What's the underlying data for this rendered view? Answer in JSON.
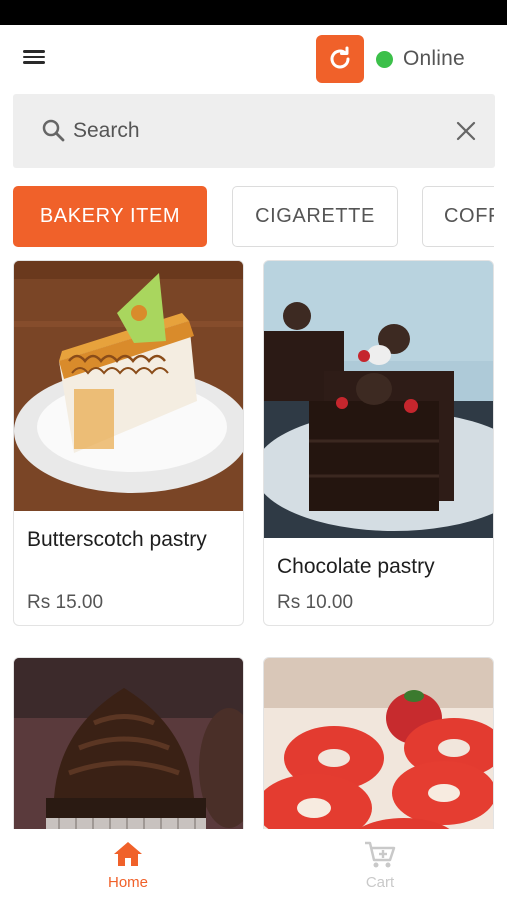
{
  "header": {
    "status": "Online",
    "colors": {
      "accent": "#f0612a",
      "online": "#3cc04a"
    },
    "icons": [
      "menu-icon",
      "refresh-icon"
    ]
  },
  "search": {
    "placeholder": "Search",
    "value": ""
  },
  "categories": [
    {
      "label": "BAKERY ITEM",
      "active": true
    },
    {
      "label": "CIGARETTE",
      "active": false
    },
    {
      "label": "COFF",
      "active": false
    }
  ],
  "products": [
    {
      "name": "Butterscotch pastry",
      "price": "Rs 15.00"
    },
    {
      "name": "Chocolate pastry",
      "price": "Rs 10.00"
    },
    {
      "name": "",
      "price": ""
    },
    {
      "name": "",
      "price": ""
    }
  ],
  "bottom_nav": [
    {
      "label": "Home",
      "icon": "home-icon",
      "active": true
    },
    {
      "label": "Cart",
      "icon": "cart-icon",
      "active": false
    }
  ]
}
